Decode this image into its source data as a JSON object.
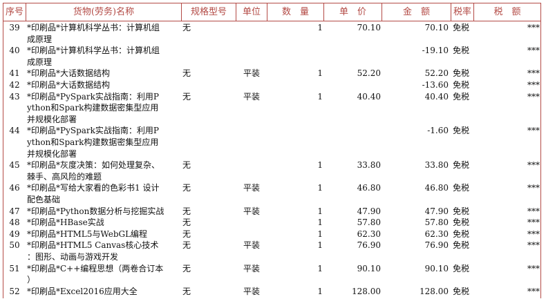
{
  "header": {
    "seq": "序号",
    "name": "货物(劳务)名称",
    "spec": "规格型号",
    "unit": "单位",
    "qty": "数　量",
    "price": "单　价",
    "amount": "金　额",
    "rate": "税率",
    "tax": "税　额"
  },
  "rows": [
    {
      "seq": "39",
      "name": [
        "*印刷品*计算机科学丛书：计算机组",
        "成原理"
      ],
      "spec": "无",
      "unit": "",
      "qty": "1",
      "price": "70.10",
      "amount": "70.10",
      "rate": "免税",
      "tax": "***"
    },
    {
      "seq": "40",
      "name": [
        "*印刷品*计算机科学丛书：计算机组",
        "成原理"
      ],
      "spec": "",
      "unit": "",
      "qty": "",
      "price": "",
      "amount": "-19.10",
      "rate": "免税",
      "tax": "***"
    },
    {
      "seq": "41",
      "name": [
        "*印刷品*大话数据结构"
      ],
      "spec": "无",
      "unit": "平装",
      "qty": "1",
      "price": "52.20",
      "amount": "52.20",
      "rate": "免税",
      "tax": "***"
    },
    {
      "seq": "42",
      "name": [
        "*印刷品*大话数据结构"
      ],
      "spec": "",
      "unit": "",
      "qty": "",
      "price": "",
      "amount": "-13.60",
      "rate": "免税",
      "tax": "***"
    },
    {
      "seq": "43",
      "name": [
        "*印刷品*PySpark实战指南：利用P",
        "ython和Spark构建数据密集型应用",
        "并规模化部署"
      ],
      "spec": "无",
      "unit": "平装",
      "qty": "1",
      "price": "40.40",
      "amount": "40.40",
      "rate": "免税",
      "tax": "***"
    },
    {
      "seq": "44",
      "name": [
        "*印刷品*PySpark实战指南：利用P",
        "ython和Spark构建数据密集型应用",
        "并规模化部署"
      ],
      "spec": "",
      "unit": "",
      "qty": "",
      "price": "",
      "amount": "-1.60",
      "rate": "免税",
      "tax": "***"
    },
    {
      "seq": "45",
      "name": [
        "*印刷品*灰度决策：如何处理复杂、",
        "棘手、高风险的难题"
      ],
      "spec": "无",
      "unit": "",
      "qty": "1",
      "price": "33.80",
      "amount": "33.80",
      "rate": "免税",
      "tax": "***"
    },
    {
      "seq": "46",
      "name": [
        "*印刷品*写给大家看的色彩书1 设计",
        "配色基础"
      ],
      "spec": "无",
      "unit": "平装",
      "qty": "1",
      "price": "46.80",
      "amount": "46.80",
      "rate": "免税",
      "tax": "***"
    },
    {
      "seq": "47",
      "name": [
        "*印刷品*Python数据分析与挖掘实战"
      ],
      "spec": "无",
      "unit": "平装",
      "qty": "1",
      "price": "47.90",
      "amount": "47.90",
      "rate": "免税",
      "tax": "***"
    },
    {
      "seq": "48",
      "name": [
        "*印刷品*HBase实战"
      ],
      "spec": "无",
      "unit": "",
      "qty": "1",
      "price": "57.80",
      "amount": "57.80",
      "rate": "免税",
      "tax": "***"
    },
    {
      "seq": "49",
      "name": [
        "*印刷品*HTML5与WebGL编程"
      ],
      "spec": "无",
      "unit": "",
      "qty": "1",
      "price": "62.30",
      "amount": "62.30",
      "rate": "免税",
      "tax": "***"
    },
    {
      "seq": "50",
      "name": [
        "*印刷品*HTML5 Canvas核心技术",
        "：图形、动画与游戏开发"
      ],
      "spec": "无",
      "unit": "平装",
      "qty": "1",
      "price": "76.90",
      "amount": "76.90",
      "rate": "免税",
      "tax": "***"
    },
    {
      "seq": "51",
      "name": [
        "*印刷品*C++编程思想（两卷合订本",
        "）"
      ],
      "spec": "无",
      "unit": "平装",
      "qty": "1",
      "price": "90.10",
      "amount": "90.10",
      "rate": "免税",
      "tax": "***"
    },
    {
      "seq": "52",
      "name": [
        "*印刷品*Excel2016应用大全"
      ],
      "spec": "无",
      "unit": "平装",
      "qty": "1",
      "price": "128.00",
      "amount": "128.00",
      "rate": "免税",
      "tax": "***"
    }
  ]
}
